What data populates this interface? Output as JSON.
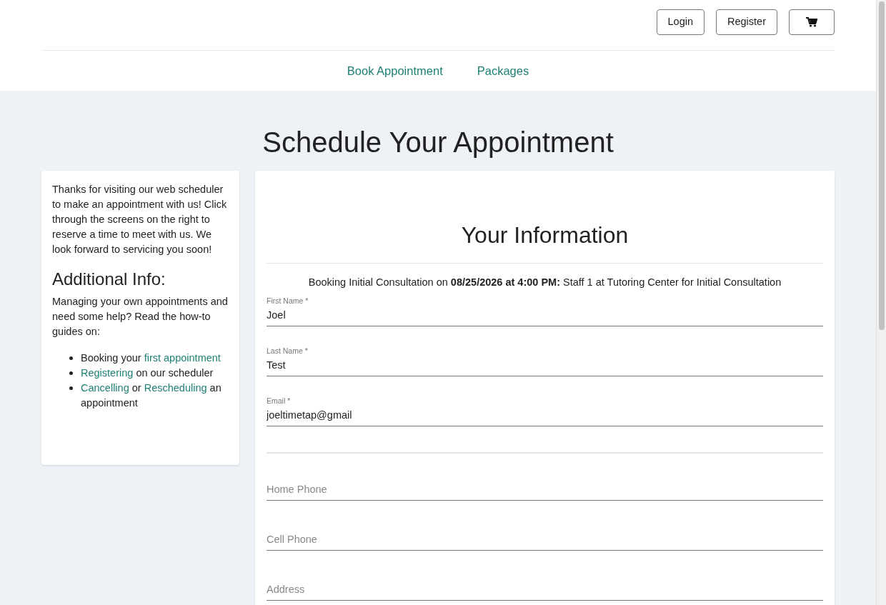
{
  "header": {
    "buttons": [
      {
        "kind": "text",
        "label": "Login"
      },
      {
        "kind": "text",
        "label": "Register"
      },
      {
        "kind": "cart"
      }
    ]
  },
  "nav": {
    "items": [
      {
        "label": "Book Appointment"
      },
      {
        "label": "Packages"
      }
    ]
  },
  "page_title": "Schedule Your Appointment",
  "sidebar": {
    "intro": "Thanks for visiting our web scheduler to make an appointment with us! Click through the screens on the right to reserve a time to meet with us. We look forward to servicing you soon!",
    "heading": "Additional Info:",
    "help": "Managing your own appointments and need some help? Read the how-to guides on:",
    "guides": [
      [
        {
          "kind": "text",
          "text": "Booking your"
        },
        {
          "kind": "link",
          "text": "first appointment"
        }
      ],
      [
        {
          "kind": "link",
          "text": "Registering"
        },
        {
          "kind": "text",
          "text": "on our scheduler"
        }
      ],
      [
        {
          "kind": "link",
          "text": "Cancelling"
        },
        {
          "kind": "text",
          "text": "or"
        },
        {
          "kind": "link",
          "text": "Rescheduling"
        },
        {
          "kind": "text",
          "text": "an appointment"
        }
      ]
    ]
  },
  "form": {
    "title": "Your Information",
    "booking": "Booking Initial Consultation on **08/25/2026 at 4:00 PM:** Staff 1 at Tutoring Center for Initial Consultation",
    "fields": [
      {
        "kind": "filled",
        "label": "First Name *",
        "value": "Joel"
      },
      {
        "kind": "filled",
        "label": "Last Name *",
        "value": "Test"
      },
      {
        "kind": "filled",
        "label": "Email *",
        "value": "joeltimetap@gmail"
      },
      {
        "kind": "divider"
      },
      {
        "kind": "empty",
        "placeholder": "Home Phone"
      },
      {
        "kind": "empty",
        "placeholder": "Cell Phone"
      },
      {
        "kind": "empty",
        "placeholder": "Address"
      }
    ]
  }
}
